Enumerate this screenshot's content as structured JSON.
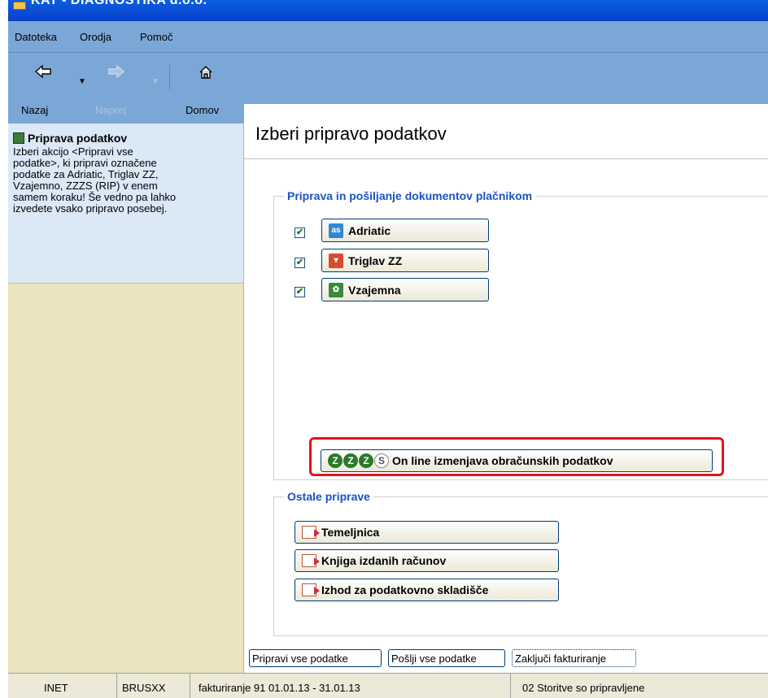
{
  "window": {
    "title": "KAT - DIAGNOSTIKA d.o.o."
  },
  "menu": {
    "items": [
      "Datoteka",
      "Orodja",
      "Pomoč"
    ]
  },
  "toolbar": {
    "back_label": "Nazaj",
    "forward_label": "Naprej",
    "home_label": "Domov"
  },
  "sidebar": {
    "title": "Priprava podatkov",
    "description": "Izberi akcijo <Pripravi vse\npodatke>, ki pripravi označene\npodatke za Adriatic, Triglav ZZ,\nVzajemno, ZZZS (RIP) v enem\nsamem koraku! Še vedno pa lahko\nizvedete vsako pripravo posebej."
  },
  "main": {
    "title": "Izberi pripravo podatkov",
    "group1": {
      "legend": "Priprava in pošiljanje dokumentov plačnikom",
      "items": [
        {
          "label": "Adriatic",
          "icon": "as-logo-icon",
          "checked": true
        },
        {
          "label": "Triglav ZZ",
          "icon": "triglav-logo-icon",
          "checked": true
        },
        {
          "label": "Vzajemna",
          "icon": "vzajemna-logo-icon",
          "checked": true
        }
      ]
    },
    "zzzs_button": {
      "logo": "ZZZS",
      "label": "On line izmenjava obračunskih podatkov"
    },
    "group2": {
      "legend": "Ostale priprave",
      "items": [
        {
          "label": "Temeljnica"
        },
        {
          "label": "Knjiga izdanih računov"
        },
        {
          "label": "Izhod za podatkovno skladišče"
        }
      ]
    },
    "actions": {
      "prepare_all": "Pripravi vse podatke",
      "send_all": "Pošlji vse podatke",
      "finish": "Zaključi fakturiranje"
    }
  },
  "status": {
    "cells": [
      "INET",
      "BRUSXX",
      "fakturiranje 91  01.01.13 - 31.01.13",
      "02 Storitve so pripravljene"
    ]
  }
}
